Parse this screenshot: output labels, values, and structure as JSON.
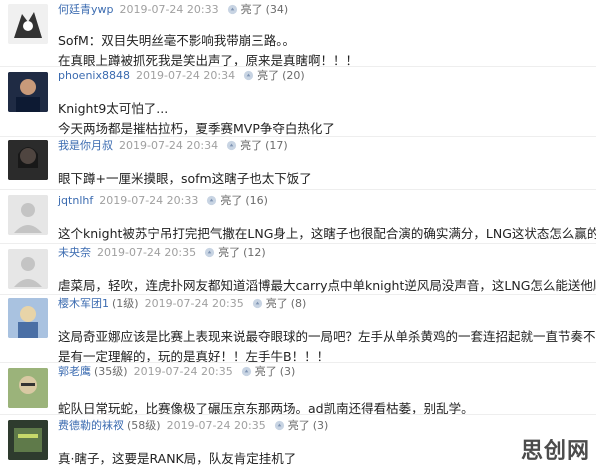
{
  "comments": [
    {
      "user": "何廷青ywp",
      "date": "2019-07-24 20:33",
      "like_label": "亮了",
      "like_count": "(34)",
      "lines": [
        "SofM：双目失明丝毫不影响我带崩三路。。",
        "在真眼上蹲被抓死我是笑出声了，原来是真瞎啊！！！"
      ]
    },
    {
      "user": "phoenix8848",
      "date": "2019-07-24 20:34",
      "like_label": "亮了",
      "like_count": "(20)",
      "lines": [
        "Knight9太可怕了...",
        "今天两场都是摧枯拉朽，夏季赛MVP争夺白热化了"
      ]
    },
    {
      "user": "我是你月叔",
      "date": "2019-07-24 20:34",
      "like_label": "亮了",
      "like_count": "(17)",
      "lines": [
        "眼下蹲+一厘米摸眼，sofm这瞎子也太下饭了"
      ]
    },
    {
      "user": "jqtnlhf",
      "date": "2019-07-24 20:33",
      "like_label": "亮了",
      "like_count": "(16)",
      "lines": [
        "这个knight被苏宁吊打完把气撒在LNG身上，这瞎子也很配合演的确实满分，LNG这状态怎么赢的棱"
      ]
    },
    {
      "user": "未央奈",
      "date": "2019-07-24 20:35",
      "like_label": "亮了",
      "like_count": "(12)",
      "lines": [
        "虐菜局，轻吹，连虎扑网友都知道滔博最大carry点中单knight逆风局没声音，这LNG怎么能送他顺风"
      ]
    },
    {
      "user": "樱木军团1",
      "level": "(1级)",
      "date": "2019-07-24 20:35",
      "like_label": "亮了",
      "like_count": "(8)",
      "lines": [
        "这局奇亚娜应该是比赛上表现来说最夺眼球的一局吧？左手从单杀黄鸡的一套连招起就一直节奏不断",
        "是有一定理解的，玩的是真好！！左手牛B！！！"
      ]
    },
    {
      "user": "郭老鹰",
      "level": "(35级)",
      "date": "2019-07-24 20:35",
      "like_label": "亮了",
      "like_count": "(3)",
      "lines": [
        "蛇队日常玩蛇，比赛像极了碾压京东那两场。ad凯南还得看枯萎，别乱学。"
      ]
    },
    {
      "user": "费德勒的袜衩",
      "level": "(58级)",
      "date": "2019-07-24 20:35",
      "like_label": "亮了",
      "like_count": "(3)",
      "lines": [
        "真·瞎子，这要是RANK局，队友肯定挂机了"
      ]
    }
  ],
  "watermark": "思创网"
}
